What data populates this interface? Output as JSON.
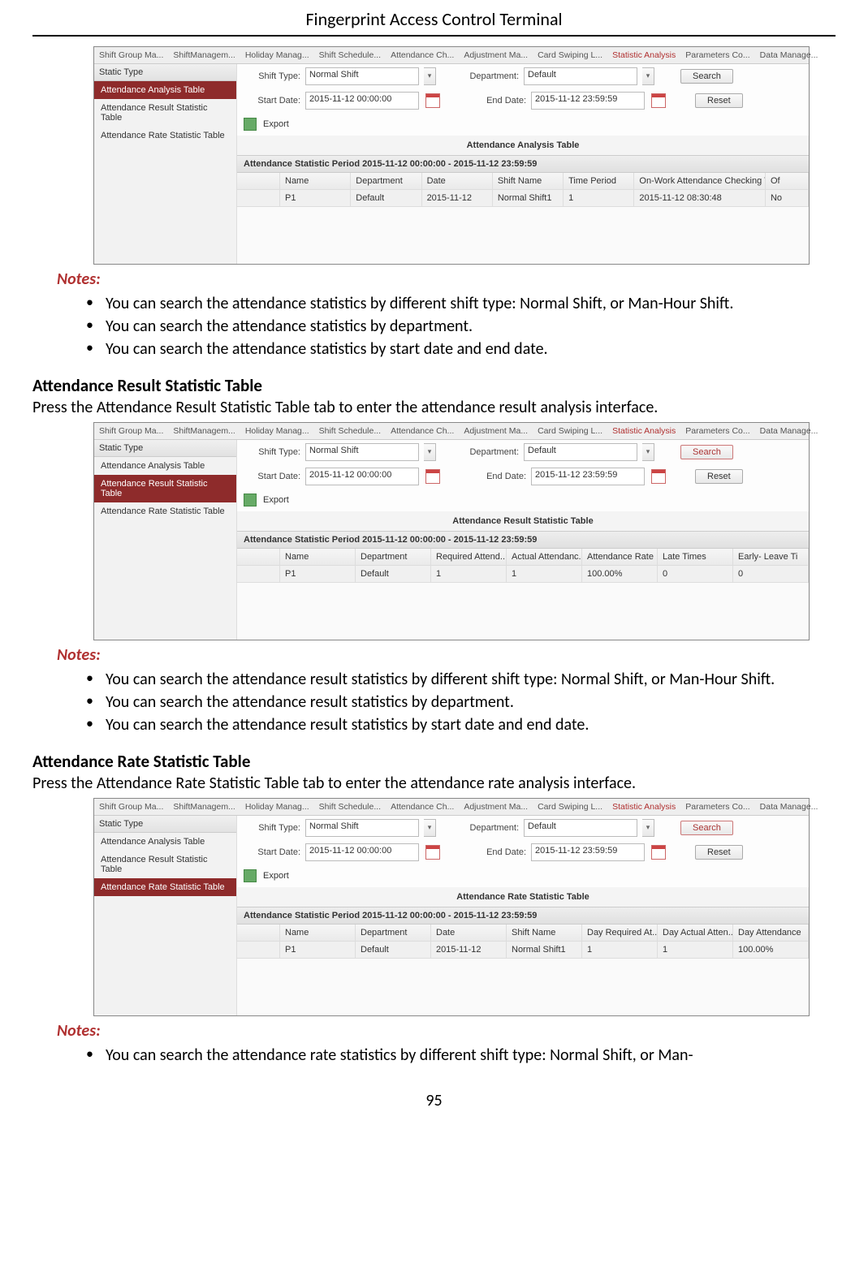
{
  "doc": {
    "header": "Fingerprint Access Control Terminal",
    "page_number": "95"
  },
  "tabs": [
    "Shift Group Ma...",
    "ShiftManagem...",
    "Holiday Manag...",
    "Shift Schedule...",
    "Attendance Ch...",
    "Adjustment Ma...",
    "Card Swiping L...",
    "Statistic Analysis",
    "Parameters Co...",
    "Data Manage..."
  ],
  "sidebar": {
    "header": "Static Type",
    "items": [
      "Attendance Analysis Table",
      "Attendance Result Statistic Table",
      "Attendance Rate Statistic Table"
    ]
  },
  "filters": {
    "shift_type_label": "Shift Type:",
    "shift_type_value": "Normal Shift",
    "department_label": "Department:",
    "department_value": "Default",
    "start_date_label": "Start Date:",
    "start_date_value": "2015-11-12 00:00:00",
    "end_date_label": "End Date:",
    "end_date_value": "2015-11-12 23:59:59",
    "search_btn": "Search",
    "reset_btn": "Reset",
    "export_btn": "Export"
  },
  "period_label": "Attendance Statistic Period 2015-11-12 00:00:00 - 2015-11-12 23:59:59",
  "screenshot1": {
    "active_sidebar": 0,
    "table_title": "Attendance Analysis Table",
    "columns": [
      "Name",
      "Department",
      "Date",
      "Shift Name",
      "Time Period",
      "On-Work Attendance Checking Time",
      "Of"
    ],
    "row": [
      "P1",
      "Default",
      "2015-11-12",
      "Normal Shift1",
      "1",
      "2015-11-12 08:30:48",
      "No"
    ]
  },
  "notes1": {
    "heading": "Notes:",
    "items": [
      "You can search the attendance statistics by different shift type: Normal Shift, or Man-Hour Shift.",
      "You can search the attendance statistics by department.",
      "You can search the attendance statistics by start date and end date."
    ]
  },
  "section2": {
    "heading": "Attendance Result Statistic Table",
    "text": "Press the Attendance Result Statistic Table tab to enter the attendance result analysis interface."
  },
  "screenshot2": {
    "active_sidebar": 1,
    "search_highlight": true,
    "table_title": "Attendance Result Statistic Table",
    "columns": [
      "Name",
      "Department",
      "Required Attend...",
      "Actual Attendanc...",
      "Attendance Rate",
      "Late Times",
      "Early- Leave Ti"
    ],
    "row": [
      "P1",
      "Default",
      "1",
      "1",
      "100.00%",
      "0",
      "0"
    ]
  },
  "notes2": {
    "heading": "Notes:",
    "items": [
      "You can search the attendance result statistics by different shift type: Normal Shift, or Man-Hour Shift.",
      "You can search the attendance result statistics by department.",
      "You can search the attendance result statistics by start date and end date."
    ]
  },
  "section3": {
    "heading": "Attendance Rate Statistic Table",
    "text": "Press the Attendance Rate Statistic Table tab to enter the attendance rate analysis interface."
  },
  "screenshot3": {
    "active_sidebar": 2,
    "search_highlight": true,
    "table_title": "Attendance Rate Statistic Table",
    "columns": [
      "Name",
      "Department",
      "Date",
      "Shift Name",
      "Day Required At...",
      "Day Actual Atten...",
      "Day Attendance"
    ],
    "row": [
      "P1",
      "Default",
      "2015-11-12",
      "Normal Shift1",
      "1",
      "1",
      "100.00%"
    ]
  },
  "notes3": {
    "heading": "Notes:",
    "items": [
      "You can search the attendance rate statistics by different shift type: Normal Shift, or Man-"
    ]
  }
}
